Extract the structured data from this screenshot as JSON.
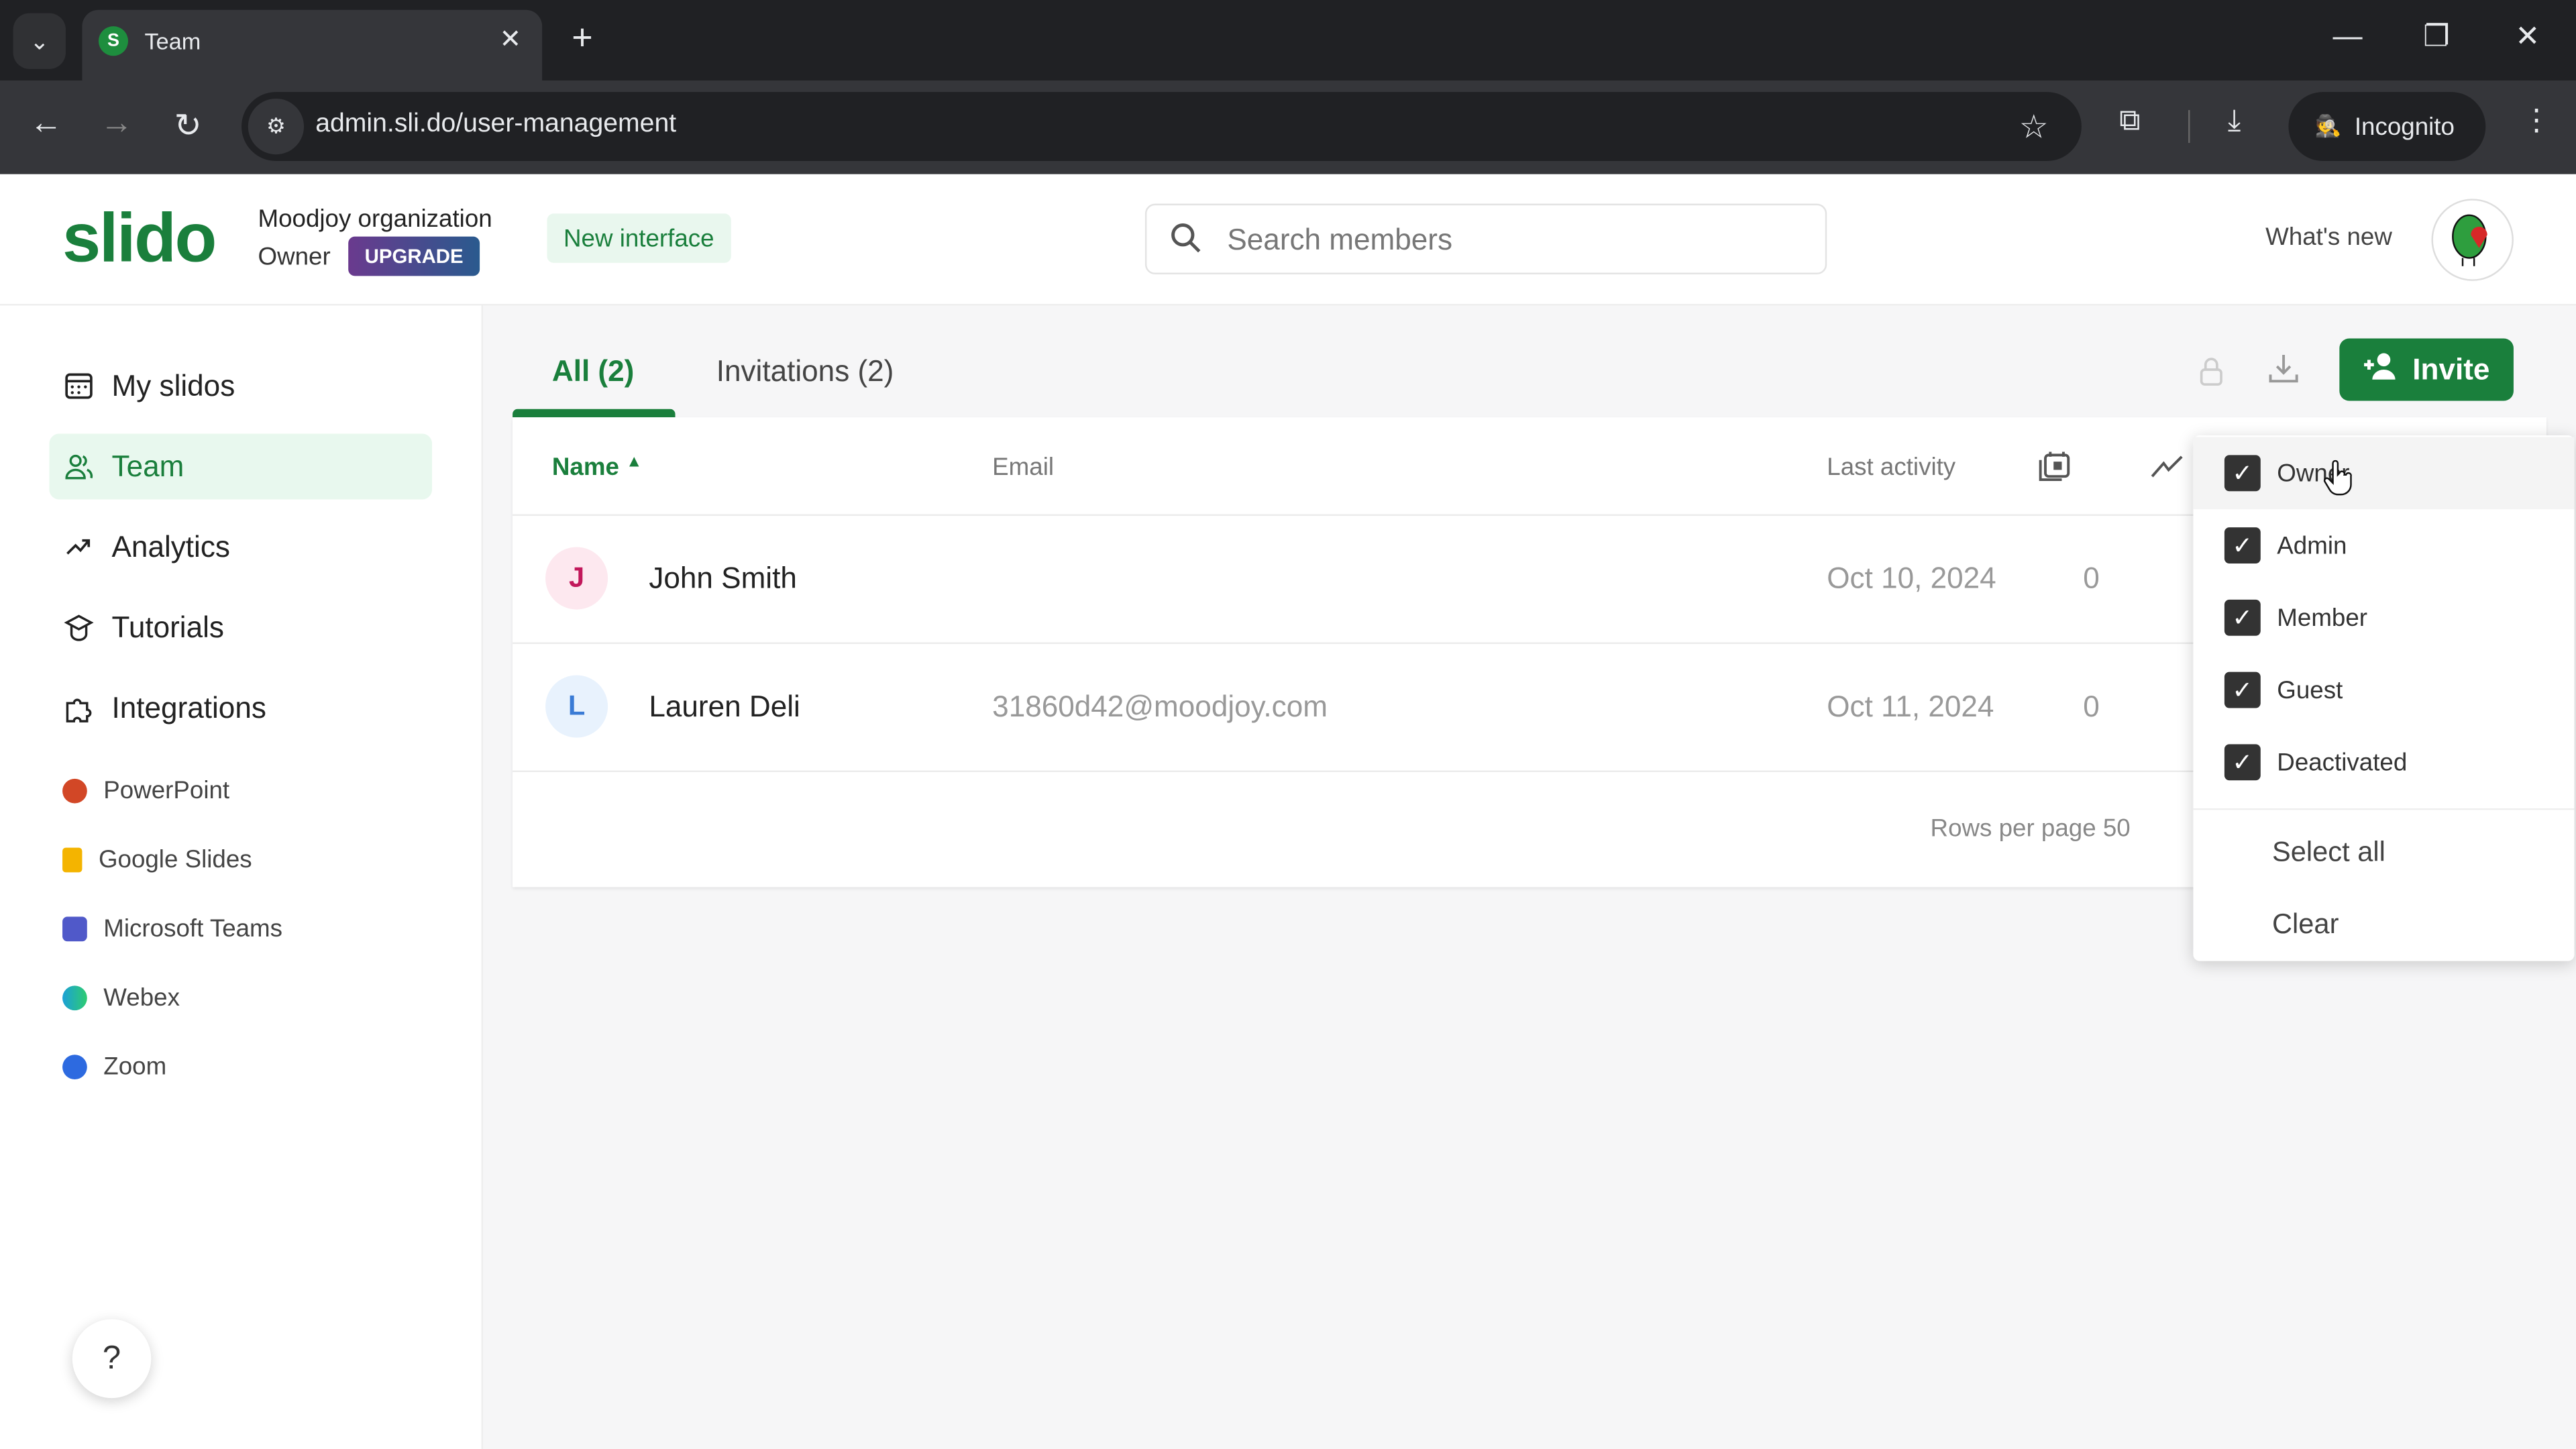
{
  "browser": {
    "tab_title": "Team",
    "tab_favicon_letter": "S",
    "url": "admin.sli.do/user-management",
    "incognito_label": "Incognito",
    "icons": {
      "tab_menu": "⌄",
      "close": "✕",
      "new_tab": "+",
      "minimize": "—",
      "restore": "❐",
      "window_close": "✕",
      "back": "←",
      "forward": "→",
      "reload": "↻",
      "site_info": "⚙",
      "star": "☆",
      "extensions": "⧉",
      "download": "⤓",
      "incognito": "🕵",
      "menu": "⋮"
    }
  },
  "header": {
    "logo": "slido",
    "org_name": "Moodjoy organization",
    "role": "Owner",
    "upgrade_label": "UPGRADE",
    "new_interface_label": "New interface",
    "search_placeholder": "Search members",
    "whats_new_label": "What's new",
    "search_icon": "⌕"
  },
  "sidebar": {
    "items": [
      {
        "label": "My slidos",
        "icon": "calendar-icon",
        "glyph": "▦",
        "active": false
      },
      {
        "label": "Team",
        "icon": "team-icon",
        "glyph": "👥",
        "active": true
      },
      {
        "label": "Analytics",
        "icon": "trend-icon",
        "glyph": "↗",
        "active": false
      },
      {
        "label": "Tutorials",
        "icon": "graduation-cap-icon",
        "glyph": "🎓",
        "active": false
      },
      {
        "label": "Integrations",
        "icon": "puzzle-icon",
        "glyph": "⧉",
        "active": false
      }
    ],
    "integrations": [
      {
        "label": "PowerPoint",
        "color": "#d24726"
      },
      {
        "label": "Google Slides",
        "color": "#f4b400"
      },
      {
        "label": "Microsoft Teams",
        "color": "#5059c9"
      },
      {
        "label": "Webex",
        "color": "#1ba0d7"
      },
      {
        "label": "Zoom",
        "color": "#2d6ae0"
      }
    ],
    "help_label": "?"
  },
  "main": {
    "tabs": [
      {
        "label": "All (2)",
        "active": true
      },
      {
        "label": "Invitations (2)",
        "active": false
      }
    ],
    "invite_label": "Invite",
    "table": {
      "columns": [
        "Name",
        "Email",
        "Last activity"
      ],
      "rows": [
        {
          "initial": "J",
          "name": "John Smith",
          "email": "",
          "last_activity": "Oct 10, 2024",
          "count": "0",
          "avatar_bg": "#fde8ef",
          "avatar_fg": "#c2185b"
        },
        {
          "initial": "L",
          "name": "Lauren Deli",
          "email": "31860d42@moodjoy.com",
          "last_activity": "Oct 11, 2024",
          "count": "0",
          "avatar_bg": "#e8f2fd",
          "avatar_fg": "#3a7bd5"
        }
      ],
      "rows_per_page": "Rows per page 50"
    }
  },
  "role_filter": {
    "options": [
      {
        "label": "Owner",
        "checked": true
      },
      {
        "label": "Admin",
        "checked": true
      },
      {
        "label": "Member",
        "checked": true
      },
      {
        "label": "Guest",
        "checked": true
      },
      {
        "label": "Deactivated",
        "checked": true
      }
    ],
    "select_all_label": "Select all",
    "clear_label": "Clear"
  },
  "colors": {
    "brand_green": "#1a7f3c",
    "active_nav_bg": "#e8f8ee"
  }
}
